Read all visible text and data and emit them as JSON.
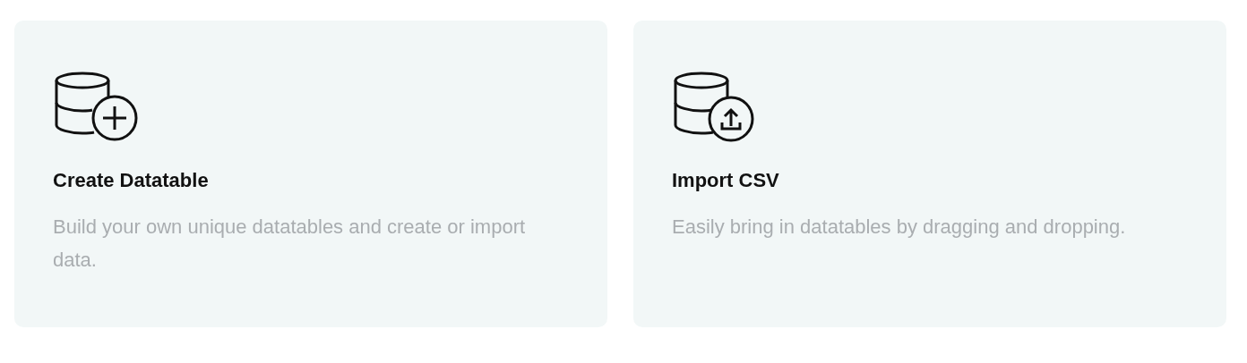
{
  "cards": [
    {
      "kind": "create",
      "title": "Create Datatable",
      "description": "Build your own unique datatables and create or import data."
    },
    {
      "kind": "import",
      "title": "Import CSV",
      "description": "Easily bring in datatables by dragging and dropping."
    }
  ]
}
